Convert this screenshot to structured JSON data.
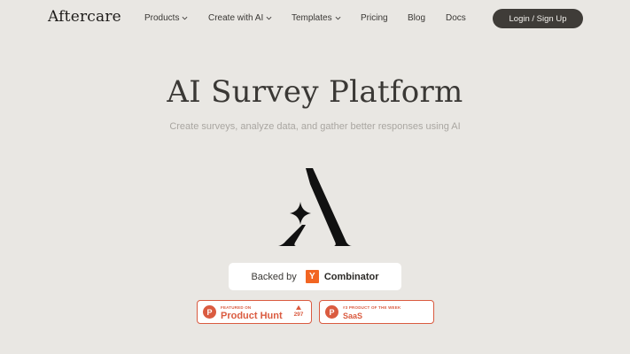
{
  "nav": {
    "logo": "Aftercare",
    "links": [
      {
        "label": "Products",
        "dropdown": true
      },
      {
        "label": "Create with AI",
        "dropdown": true
      },
      {
        "label": "Templates",
        "dropdown": true
      },
      {
        "label": "Pricing",
        "dropdown": false
      },
      {
        "label": "Blog",
        "dropdown": false
      },
      {
        "label": "Docs",
        "dropdown": false
      }
    ],
    "login_label": "Login / Sign Up"
  },
  "hero": {
    "title": "AI Survey Platform",
    "subtitle": "Create surveys, analyze data, and gather better responses using AI"
  },
  "backed": {
    "label": "Backed by",
    "yc_letter": "Y",
    "yc_name": "Combinator"
  },
  "badges": {
    "product_hunt": {
      "letter": "P",
      "small": "FEATURED ON",
      "big": "Product Hunt",
      "votes": "297"
    },
    "product_week": {
      "letter": "P",
      "small": "#3 PRODUCT OF THE WEEK",
      "big": "SaaS"
    }
  },
  "colors": {
    "background": "#e9e7e3",
    "button_dark": "#3f3c38",
    "yc_orange": "#f26522",
    "ph_red": "#da5b40"
  }
}
